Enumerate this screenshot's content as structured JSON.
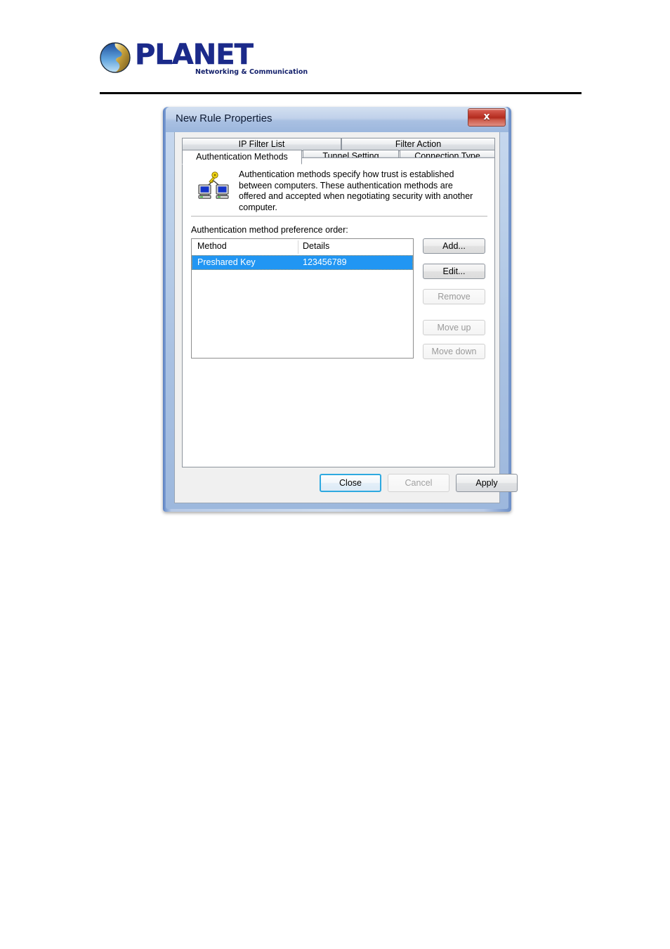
{
  "brand": {
    "wordmark": "PLANET",
    "tagline": "Networking & Communication",
    "logo_icon": "planet-globe-icon"
  },
  "dialog": {
    "title": "New Rule Properties",
    "close_icon": "close-icon",
    "close_label": "x",
    "tabs": {
      "row1": [
        {
          "label": "IP Filter List",
          "selected": false
        },
        {
          "label": "Filter Action",
          "selected": false
        }
      ],
      "row2": [
        {
          "label": "Authentication Methods",
          "selected": true
        },
        {
          "label": "Tunnel Setting",
          "selected": false
        },
        {
          "label": "Connection Type",
          "selected": false
        }
      ]
    },
    "description": {
      "icon": "key-and-computers-icon",
      "text": "Authentication methods specify how trust is established between computers. These authentication methods are offered and accepted when negotiating security with another computer."
    },
    "list_label": "Authentication method preference order:",
    "list": {
      "columns": [
        "Method",
        "Details"
      ],
      "rows": [
        {
          "method": "Preshared Key",
          "details": "123456789",
          "selected": true
        }
      ]
    },
    "side_buttons": [
      {
        "label": "Add...",
        "enabled": true
      },
      {
        "label": "Edit...",
        "enabled": true
      },
      {
        "label": "Remove",
        "enabled": false
      },
      {
        "label": "Move up",
        "enabled": false
      },
      {
        "label": "Move down",
        "enabled": false
      }
    ],
    "footer_buttons": [
      {
        "label": "Close",
        "state": "default"
      },
      {
        "label": "Cancel",
        "state": "disabled"
      },
      {
        "label": "Apply",
        "state": "enabled"
      }
    ]
  },
  "colors": {
    "selection_blue": "#2196f3",
    "titlebar_blue": "#a9c0e2",
    "close_red": "#b32a1d",
    "default_button_outline": "#2ea9e0",
    "brand_blue": "#1b2a8a"
  }
}
